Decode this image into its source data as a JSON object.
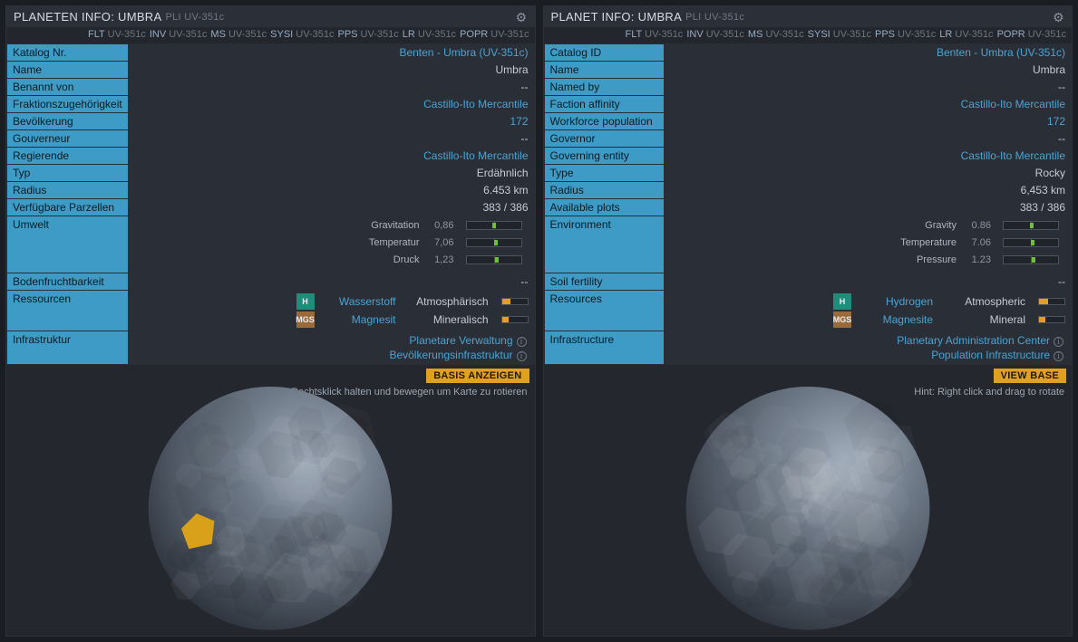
{
  "panels": [
    {
      "title": "PLANETEN INFO: UMBRA",
      "subtitle": "PLI UV-351c",
      "context": [
        {
          "cmd": "FLT",
          "arg": "UV-351c"
        },
        {
          "cmd": "INV",
          "arg": "UV-351c"
        },
        {
          "cmd": "MS",
          "arg": "UV-351c"
        },
        {
          "cmd": "SYSI",
          "arg": "UV-351c"
        },
        {
          "cmd": "PPS",
          "arg": "UV-351c"
        },
        {
          "cmd": "LR",
          "arg": "UV-351c"
        },
        {
          "cmd": "POPR",
          "arg": "UV-351c"
        }
      ],
      "rows": {
        "catalog_label": "Katalog Nr.",
        "catalog_value": "Benten - Umbra (UV-351c)",
        "name_label": "Name",
        "name_value": "Umbra",
        "namedby_label": "Benannt von",
        "namedby_value": "--",
        "faction_label": "Fraktionszugehörigkeit",
        "faction_value": "Castillo-Ito Mercantile",
        "pop_label": "Bevölkerung",
        "pop_value": "172",
        "governor_label": "Gouverneur",
        "governor_value": "--",
        "governing_label": "Regierende",
        "governing_value": "Castillo-Ito Mercantile",
        "type_label": "Typ",
        "type_value": "Erdähnlich",
        "radius_label": "Radius",
        "radius_value": "6.453 km",
        "plots_label": "Verfügbare Parzellen",
        "plots_value": "383 / 386",
        "env_label": "Umwelt",
        "fert_label": "Bodenfruchtbarkeit",
        "fert_value": "--",
        "res_label": "Ressourcen",
        "infra_label": "Infrastruktur"
      },
      "env": [
        {
          "k": "Gravitation",
          "v": "0,86",
          "pos": 48
        },
        {
          "k": "Temperatur",
          "v": "7,06",
          "pos": 50
        },
        {
          "k": "Druck",
          "v": "1,23",
          "pos": 52
        }
      ],
      "resources": [
        {
          "badge": "H",
          "bcolor": "#1f8d7a",
          "name": "Wasserstoff",
          "type": "Atmosphärisch",
          "fill": 35
        },
        {
          "badge": "MGS",
          "bcolor": "#9a6a3a",
          "name": "Magnesit",
          "type": "Mineralisch",
          "fill": 25
        }
      ],
      "infra": [
        "Planetare Verwaltung",
        "Bevölkerungsinfrastruktur"
      ],
      "view_base": "BASIS ANZEIGEN",
      "hint": "Tipp: Rechtsklick halten und bewegen um Karte zu rotieren",
      "show_base_marker": true
    },
    {
      "title": "PLANET INFO: UMBRA",
      "subtitle": "PLI UV-351c",
      "context": [
        {
          "cmd": "FLT",
          "arg": "UV-351c"
        },
        {
          "cmd": "INV",
          "arg": "UV-351c"
        },
        {
          "cmd": "MS",
          "arg": "UV-351c"
        },
        {
          "cmd": "SYSI",
          "arg": "UV-351c"
        },
        {
          "cmd": "PPS",
          "arg": "UV-351c"
        },
        {
          "cmd": "LR",
          "arg": "UV-351c"
        },
        {
          "cmd": "POPR",
          "arg": "UV-351c"
        }
      ],
      "rows": {
        "catalog_label": "Catalog ID",
        "catalog_value": "Benten - Umbra (UV-351c)",
        "name_label": "Name",
        "name_value": "Umbra",
        "namedby_label": "Named by",
        "namedby_value": "--",
        "faction_label": "Faction affinity",
        "faction_value": "Castillo-Ito Mercantile",
        "pop_label": "Workforce population",
        "pop_value": "172",
        "governor_label": "Governor",
        "governor_value": "--",
        "governing_label": "Governing entity",
        "governing_value": "Castillo-Ito Mercantile",
        "type_label": "Type",
        "type_value": "Rocky",
        "radius_label": "Radius",
        "radius_value": "6,453 km",
        "plots_label": "Available plots",
        "plots_value": "383 / 386",
        "env_label": "Environment",
        "fert_label": "Soil fertility",
        "fert_value": "--",
        "res_label": "Resources",
        "infra_label": "Infrastructure"
      },
      "env": [
        {
          "k": "Gravity",
          "v": "0.86",
          "pos": 48
        },
        {
          "k": "Temperature",
          "v": "7.06",
          "pos": 50
        },
        {
          "k": "Pressure",
          "v": "1.23",
          "pos": 52
        }
      ],
      "resources": [
        {
          "badge": "H",
          "bcolor": "#1f8d7a",
          "name": "Hydrogen",
          "type": "Atmospheric",
          "fill": 35
        },
        {
          "badge": "MGS",
          "bcolor": "#9a6a3a",
          "name": "Magnesite",
          "type": "Mineral",
          "fill": 25
        }
      ],
      "infra": [
        "Planetary Administration Center",
        "Population Infrastructure"
      ],
      "view_base": "VIEW BASE",
      "hint": "Hint: Right click and drag to rotate",
      "show_base_marker": false
    }
  ]
}
